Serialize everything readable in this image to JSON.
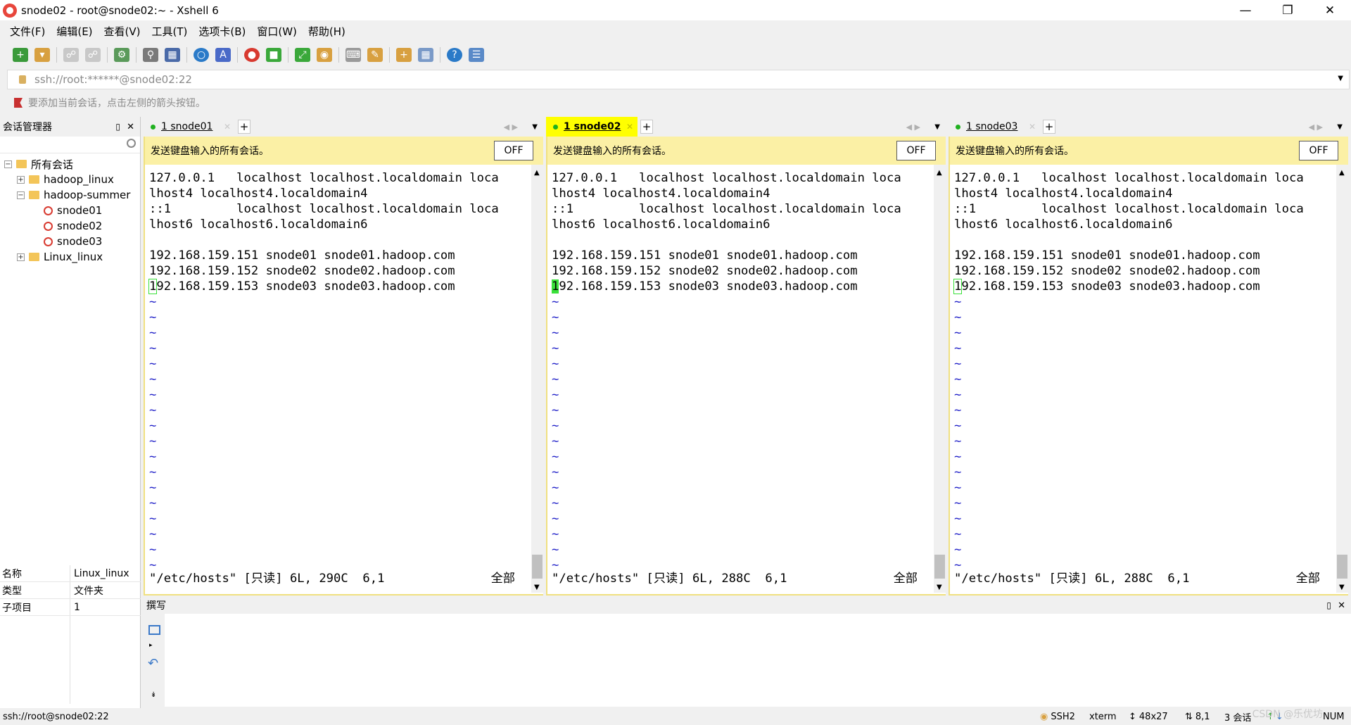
{
  "window": {
    "title": "snode02 - root@snode02:~ - Xshell 6"
  },
  "menu": [
    "文件(F)",
    "编辑(E)",
    "查看(V)",
    "工具(T)",
    "选项卡(B)",
    "窗口(W)",
    "帮助(H)"
  ],
  "address": {
    "value": "ssh://root:******@snode02:22"
  },
  "hint": "要添加当前会话，点击左侧的箭头按钮。",
  "sidebar": {
    "title": "会话管理器",
    "tree": {
      "root": "所有会话",
      "f1": "hadoop_linux",
      "f2": "hadoop-summer",
      "s1": "snode01",
      "s2": "snode02",
      "s3": "snode03",
      "f3": "Linux_linux"
    },
    "props": [
      {
        "k": "名称",
        "v": "Linux_linux"
      },
      {
        "k": "类型",
        "v": "文件夹"
      },
      {
        "k": "子项目",
        "v": "1"
      }
    ]
  },
  "panes": [
    {
      "tab": "1 snode01",
      "send": "发送键盘输入的所有会话。",
      "off": "OFF",
      "status": "\"/etc/hosts\" [只读] 6L, 290C  6,1",
      "status_right": "全部"
    },
    {
      "tab": "1 snode02",
      "send": "发送键盘输入的所有会话。",
      "off": "OFF",
      "status": "\"/etc/hosts\" [只读] 6L, 288C  6,1",
      "status_right": "全部"
    },
    {
      "tab": "1 snode03",
      "send": "发送键盘输入的所有会话。",
      "off": "OFF",
      "status": "\"/etc/hosts\" [只读] 6L, 288C  6,1",
      "status_right": "全部"
    }
  ],
  "terminal": {
    "l1": "127.0.0.1   localhost localhost.localdomain loca",
    "l2": "lhost4 localhost4.localdomain4",
    "l3": "::1         localhost localhost.localdomain loca",
    "l4": "lhost6 localhost6.localdomain6",
    "l5": "",
    "l6": "192.168.159.151 snode01 snode01.hadoop.com",
    "l7": "192.168.159.152 snode02 snode02.hadoop.com",
    "l8_first": "1",
    "l8_rest": "92.168.159.153 snode03 snode03.hadoop.com",
    "tilde": "~"
  },
  "compose": {
    "title": "撰写"
  },
  "statusbar": {
    "left": "ssh://root@snode02:22",
    "protocol": "SSH2",
    "term": "xterm",
    "size": "48x27",
    "pos": "8,1",
    "sessions": "3 会话",
    "num": "NUM",
    "watermark": "CSDN @乐优坊"
  },
  "colors": {
    "active_tab": "#ffff00",
    "sendbar": "#fbf0a5",
    "tilde": "#2020c8",
    "cursor": "#3ae03a"
  }
}
